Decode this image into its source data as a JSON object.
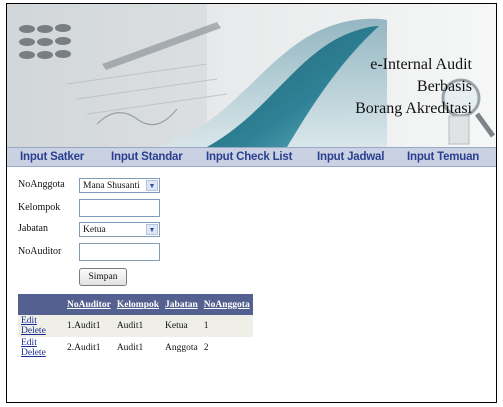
{
  "header": {
    "title_lines": [
      "e-Internal Audit",
      "Berbasis",
      "Borang Akreditasi"
    ]
  },
  "nav": {
    "items": [
      {
        "label": "Input Satker"
      },
      {
        "label": "Input Standar"
      },
      {
        "label": "Input Check List"
      },
      {
        "label": "Input Jadwal"
      },
      {
        "label": "Input Temuan"
      }
    ]
  },
  "form": {
    "no_anggota": {
      "label": "NoAnggota",
      "value": "Mana Shusanti"
    },
    "kelompok": {
      "label": "Kelompok",
      "value": ""
    },
    "jabatan": {
      "label": "Jabatan",
      "value": "Ketua"
    },
    "no_auditor": {
      "label": "NoAuditor",
      "value": ""
    },
    "submit_label": "Simpan"
  },
  "table": {
    "columns": [
      "NoAuditor",
      "Kelompok",
      "Jabatan",
      "NoAnggota"
    ],
    "edit_label": "Edit",
    "delete_label": "Delete",
    "rows": [
      {
        "no_auditor": "1.Audit1",
        "kelompok": "Audit1",
        "jabatan": "Ketua",
        "no_anggota": "1"
      },
      {
        "no_auditor": "2.Audit1",
        "kelompok": "Audit1",
        "jabatan": "Anggota",
        "no_anggota": "2"
      }
    ]
  },
  "colors": {
    "nav_bg": "#c9d1e3",
    "nav_text": "#2a3f8f",
    "table_header_bg": "#54608f",
    "alt_row_bg": "#efefe7",
    "link": "#1a2f8f"
  }
}
